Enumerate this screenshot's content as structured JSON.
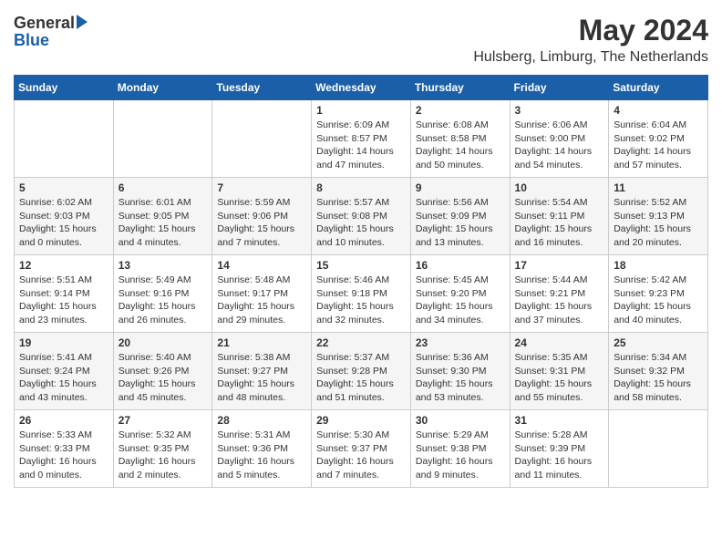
{
  "header": {
    "logo_general": "General",
    "logo_blue": "Blue",
    "month_year": "May 2024",
    "location": "Hulsberg, Limburg, The Netherlands"
  },
  "weekdays": [
    "Sunday",
    "Monday",
    "Tuesday",
    "Wednesday",
    "Thursday",
    "Friday",
    "Saturday"
  ],
  "rows": [
    [
      {
        "day": "",
        "info": ""
      },
      {
        "day": "",
        "info": ""
      },
      {
        "day": "",
        "info": ""
      },
      {
        "day": "1",
        "info": "Sunrise: 6:09 AM\nSunset: 8:57 PM\nDaylight: 14 hours\nand 47 minutes."
      },
      {
        "day": "2",
        "info": "Sunrise: 6:08 AM\nSunset: 8:58 PM\nDaylight: 14 hours\nand 50 minutes."
      },
      {
        "day": "3",
        "info": "Sunrise: 6:06 AM\nSunset: 9:00 PM\nDaylight: 14 hours\nand 54 minutes."
      },
      {
        "day": "4",
        "info": "Sunrise: 6:04 AM\nSunset: 9:02 PM\nDaylight: 14 hours\nand 57 minutes."
      }
    ],
    [
      {
        "day": "5",
        "info": "Sunrise: 6:02 AM\nSunset: 9:03 PM\nDaylight: 15 hours\nand 0 minutes."
      },
      {
        "day": "6",
        "info": "Sunrise: 6:01 AM\nSunset: 9:05 PM\nDaylight: 15 hours\nand 4 minutes."
      },
      {
        "day": "7",
        "info": "Sunrise: 5:59 AM\nSunset: 9:06 PM\nDaylight: 15 hours\nand 7 minutes."
      },
      {
        "day": "8",
        "info": "Sunrise: 5:57 AM\nSunset: 9:08 PM\nDaylight: 15 hours\nand 10 minutes."
      },
      {
        "day": "9",
        "info": "Sunrise: 5:56 AM\nSunset: 9:09 PM\nDaylight: 15 hours\nand 13 minutes."
      },
      {
        "day": "10",
        "info": "Sunrise: 5:54 AM\nSunset: 9:11 PM\nDaylight: 15 hours\nand 16 minutes."
      },
      {
        "day": "11",
        "info": "Sunrise: 5:52 AM\nSunset: 9:13 PM\nDaylight: 15 hours\nand 20 minutes."
      }
    ],
    [
      {
        "day": "12",
        "info": "Sunrise: 5:51 AM\nSunset: 9:14 PM\nDaylight: 15 hours\nand 23 minutes."
      },
      {
        "day": "13",
        "info": "Sunrise: 5:49 AM\nSunset: 9:16 PM\nDaylight: 15 hours\nand 26 minutes."
      },
      {
        "day": "14",
        "info": "Sunrise: 5:48 AM\nSunset: 9:17 PM\nDaylight: 15 hours\nand 29 minutes."
      },
      {
        "day": "15",
        "info": "Sunrise: 5:46 AM\nSunset: 9:18 PM\nDaylight: 15 hours\nand 32 minutes."
      },
      {
        "day": "16",
        "info": "Sunrise: 5:45 AM\nSunset: 9:20 PM\nDaylight: 15 hours\nand 34 minutes."
      },
      {
        "day": "17",
        "info": "Sunrise: 5:44 AM\nSunset: 9:21 PM\nDaylight: 15 hours\nand 37 minutes."
      },
      {
        "day": "18",
        "info": "Sunrise: 5:42 AM\nSunset: 9:23 PM\nDaylight: 15 hours\nand 40 minutes."
      }
    ],
    [
      {
        "day": "19",
        "info": "Sunrise: 5:41 AM\nSunset: 9:24 PM\nDaylight: 15 hours\nand 43 minutes."
      },
      {
        "day": "20",
        "info": "Sunrise: 5:40 AM\nSunset: 9:26 PM\nDaylight: 15 hours\nand 45 minutes."
      },
      {
        "day": "21",
        "info": "Sunrise: 5:38 AM\nSunset: 9:27 PM\nDaylight: 15 hours\nand 48 minutes."
      },
      {
        "day": "22",
        "info": "Sunrise: 5:37 AM\nSunset: 9:28 PM\nDaylight: 15 hours\nand 51 minutes."
      },
      {
        "day": "23",
        "info": "Sunrise: 5:36 AM\nSunset: 9:30 PM\nDaylight: 15 hours\nand 53 minutes."
      },
      {
        "day": "24",
        "info": "Sunrise: 5:35 AM\nSunset: 9:31 PM\nDaylight: 15 hours\nand 55 minutes."
      },
      {
        "day": "25",
        "info": "Sunrise: 5:34 AM\nSunset: 9:32 PM\nDaylight: 15 hours\nand 58 minutes."
      }
    ],
    [
      {
        "day": "26",
        "info": "Sunrise: 5:33 AM\nSunset: 9:33 PM\nDaylight: 16 hours\nand 0 minutes."
      },
      {
        "day": "27",
        "info": "Sunrise: 5:32 AM\nSunset: 9:35 PM\nDaylight: 16 hours\nand 2 minutes."
      },
      {
        "day": "28",
        "info": "Sunrise: 5:31 AM\nSunset: 9:36 PM\nDaylight: 16 hours\nand 5 minutes."
      },
      {
        "day": "29",
        "info": "Sunrise: 5:30 AM\nSunset: 9:37 PM\nDaylight: 16 hours\nand 7 minutes."
      },
      {
        "day": "30",
        "info": "Sunrise: 5:29 AM\nSunset: 9:38 PM\nDaylight: 16 hours\nand 9 minutes."
      },
      {
        "day": "31",
        "info": "Sunrise: 5:28 AM\nSunset: 9:39 PM\nDaylight: 16 hours\nand 11 minutes."
      },
      {
        "day": "",
        "info": ""
      }
    ]
  ]
}
